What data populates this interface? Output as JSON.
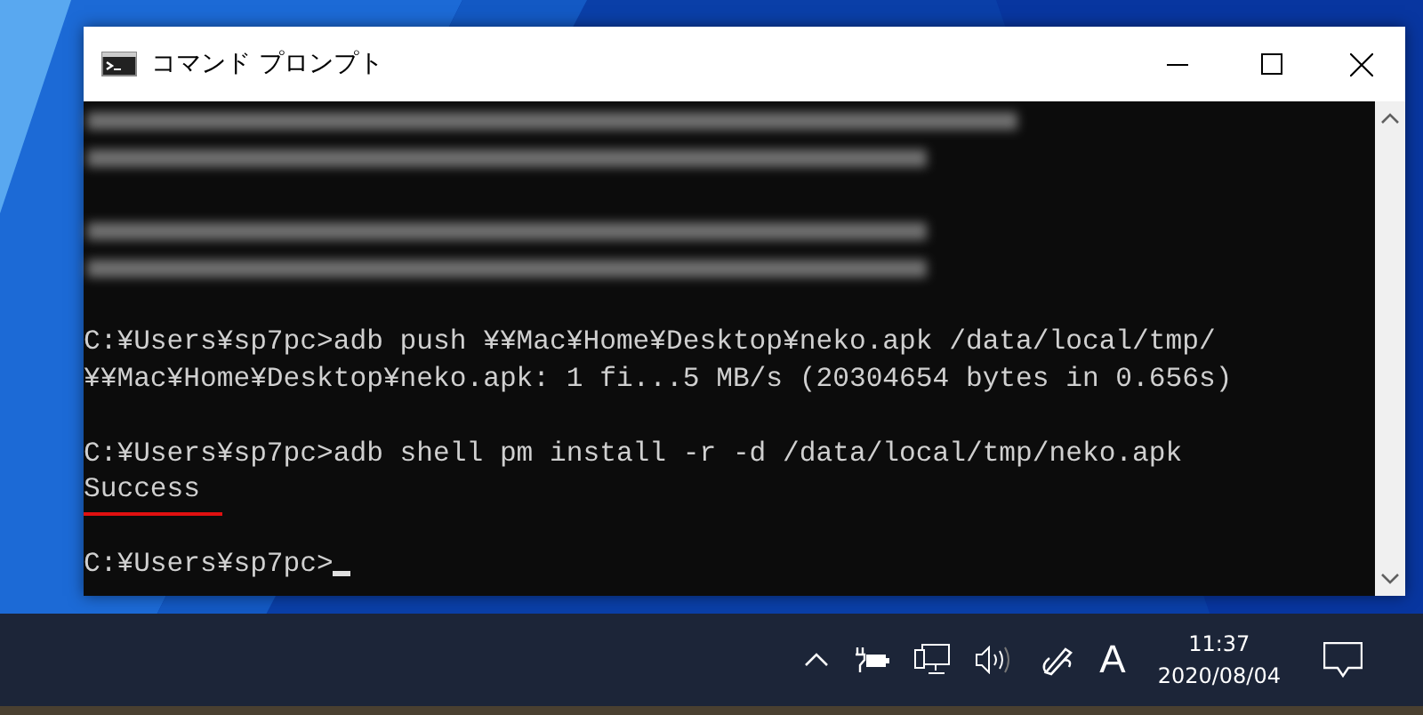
{
  "window": {
    "title": "コマンド プロンプト",
    "controls": [
      {
        "kind": "minimize"
      },
      {
        "kind": "maximize"
      },
      {
        "kind": "close"
      }
    ]
  },
  "console": {
    "lines": [
      {
        "kind": "blurred"
      },
      {
        "kind": "blurred"
      },
      {
        "kind": "blank"
      },
      {
        "kind": "blurred"
      },
      {
        "kind": "blurred"
      },
      {
        "kind": "blank"
      },
      {
        "kind": "text",
        "text": "C:¥Users¥sp7pc>adb push ¥¥Mac¥Home¥Desktop¥neko.apk /data/local/tmp/"
      },
      {
        "kind": "text",
        "text": "¥¥Mac¥Home¥Desktop¥neko.apk: 1 fi...5 MB/s (20304654 bytes in 0.656s)"
      },
      {
        "kind": "blank"
      },
      {
        "kind": "text",
        "text": "C:¥Users¥sp7pc>adb shell pm install -r -d /data/local/tmp/neko.apk"
      },
      {
        "kind": "text",
        "text": "Success",
        "underlined": true
      },
      {
        "kind": "blank"
      },
      {
        "kind": "text",
        "text": "C:¥Users¥sp7pc>",
        "cursor": true
      }
    ]
  },
  "taskbar": {
    "tray": [
      {
        "kind": "chevron"
      },
      {
        "kind": "battery"
      },
      {
        "kind": "network"
      },
      {
        "kind": "volume"
      },
      {
        "kind": "pen"
      }
    ],
    "ime": "A",
    "time": "11:37",
    "date": "2020/08/04"
  }
}
